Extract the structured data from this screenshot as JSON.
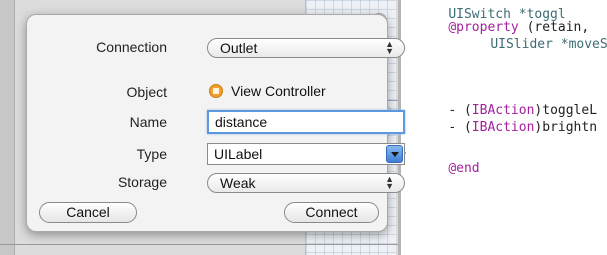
{
  "code": {
    "line1_text": "UISwitch *toggl",
    "line2_keyword": "@property",
    "line2_rest": " (retain,",
    "line3_text": "UISlider *moveS",
    "line4_prefix": "- (",
    "line4_keyword": "IBAction",
    "line4_rest": ")toggleL",
    "line5_prefix": "- (",
    "line5_keyword": "IBAction",
    "line5_rest": ")brightn",
    "line6_keyword": "@end"
  },
  "popover": {
    "connection": {
      "label": "Connection",
      "value": "Outlet"
    },
    "object": {
      "label": "Object",
      "value": "View Controller",
      "icon": "view-controller-icon"
    },
    "name": {
      "label": "Name",
      "value": "distance"
    },
    "type": {
      "label": "Type",
      "value": "UILabel"
    },
    "storage": {
      "label": "Storage",
      "value": "Weak"
    },
    "cancel_label": "Cancel",
    "connect_label": "Connect"
  },
  "colors": {
    "focus_ring": "#5e98dc",
    "keyword": "#a3219e",
    "object_icon": "#f0a12b"
  }
}
